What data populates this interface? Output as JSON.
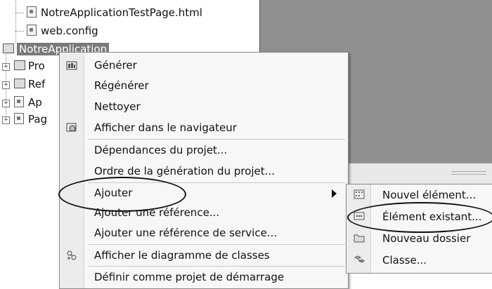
{
  "tree": {
    "items": [
      {
        "label": "NotreApplicationTestPage.html"
      },
      {
        "label": "web.config"
      }
    ],
    "project": {
      "label": "NotreApplication"
    },
    "folders": [
      {
        "label": "Pro"
      },
      {
        "label": "Ref"
      },
      {
        "label": "Ap"
      },
      {
        "label": "Pag"
      }
    ]
  },
  "context_menu": {
    "items": [
      {
        "label": "Générer",
        "icon": "build-icon"
      },
      {
        "label": "Régénérer"
      },
      {
        "label": "Nettoyer"
      },
      {
        "label": "Afficher dans le navigateur",
        "icon": "browser-icon"
      },
      {
        "label": "Dépendances du projet..."
      },
      {
        "label": "Ordre de la génération du projet..."
      },
      {
        "label": "Ajouter"
      },
      {
        "label": "Ajouter une référence..."
      },
      {
        "label": "Ajouter une référence de service..."
      },
      {
        "label": "Afficher le diagramme de classes",
        "icon": "class-diagram-icon"
      },
      {
        "label": "Définir comme projet de démarrage"
      }
    ]
  },
  "submenu": {
    "items": [
      {
        "label": "Nouvel élément...",
        "icon": "new-item-icon"
      },
      {
        "label": "Élément existant...",
        "icon": "existing-item-icon"
      },
      {
        "label": "Nouveau dossier",
        "icon": "folder-icon"
      },
      {
        "label": "Classe...",
        "icon": "class-icon"
      }
    ]
  }
}
